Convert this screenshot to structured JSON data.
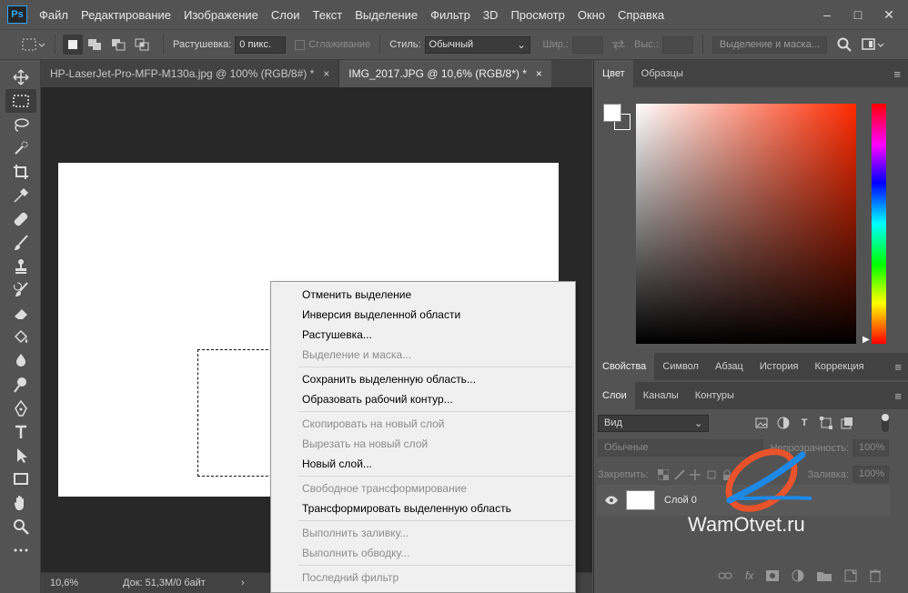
{
  "app": {
    "logo": "Ps"
  },
  "menu": [
    "Файл",
    "Редактирование",
    "Изображение",
    "Слои",
    "Текст",
    "Выделение",
    "Фильтр",
    "3D",
    "Просмотр",
    "Окно",
    "Справка"
  ],
  "window_controls": [
    "–",
    "□",
    "✕"
  ],
  "options": {
    "feather_label": "Растушевка:",
    "feather_value": "0 пикс.",
    "antialias_label": "Сглаживание",
    "style_label": "Стиль:",
    "style_value": "Обычный",
    "width_label": "Шир.:",
    "height_label": "Выс.:",
    "mask_button": "Выделение и маска..."
  },
  "tabs": [
    {
      "label": "HP-LaserJet-Pro-MFP-M130a.jpg @ 100% (RGB/8#) *",
      "close": "×"
    },
    {
      "label": "IMG_2017.JPG @ 10,6% (RGB/8*) *",
      "close": "×"
    }
  ],
  "status": {
    "zoom": "10,6%",
    "doc": "Док: 51,3M/0 байт",
    "arrow": "›"
  },
  "context_menu": [
    {
      "label": "Отменить выделение",
      "enabled": true
    },
    {
      "label": "Инверсия выделенной области",
      "enabled": true
    },
    {
      "label": "Растушевка...",
      "enabled": true
    },
    {
      "label": "Выделение и маска...",
      "enabled": false
    },
    {
      "label": "Сохранить выделенную область...",
      "enabled": true
    },
    {
      "label": "Образовать рабочий контур...",
      "enabled": true
    },
    {
      "label": "Скопировать на новый слой",
      "enabled": false
    },
    {
      "label": "Вырезать на новый слой",
      "enabled": false
    },
    {
      "label": "Новый слой...",
      "enabled": true
    },
    {
      "label": "Свободное трансформирование",
      "enabled": false
    },
    {
      "label": "Трансформировать выделенную область",
      "enabled": true
    },
    {
      "label": "Выполнить заливку...",
      "enabled": false
    },
    {
      "label": "Выполнить обводку...",
      "enabled": false
    },
    {
      "label": "Последний фильтр",
      "enabled": false
    }
  ],
  "color_panel": {
    "tabs": [
      "Цвет",
      "Образцы"
    ],
    "menu": "≡"
  },
  "props_panel": {
    "tabs": [
      "Свойства",
      "Символ",
      "Абзац",
      "История",
      "Коррекция"
    ]
  },
  "layers_panel": {
    "tabs": [
      "Слои",
      "Каналы",
      "Контуры"
    ],
    "filter": "Вид",
    "blend_mode": "Обычные",
    "opacity_label": "Непрозрачность:",
    "opacity_value": "100%",
    "lock_label": "Закрепить:",
    "fill_label": "Заливка:",
    "fill_value": "100%",
    "layer_name": "Слой 0"
  },
  "watermark": "WamOtvet.ru"
}
